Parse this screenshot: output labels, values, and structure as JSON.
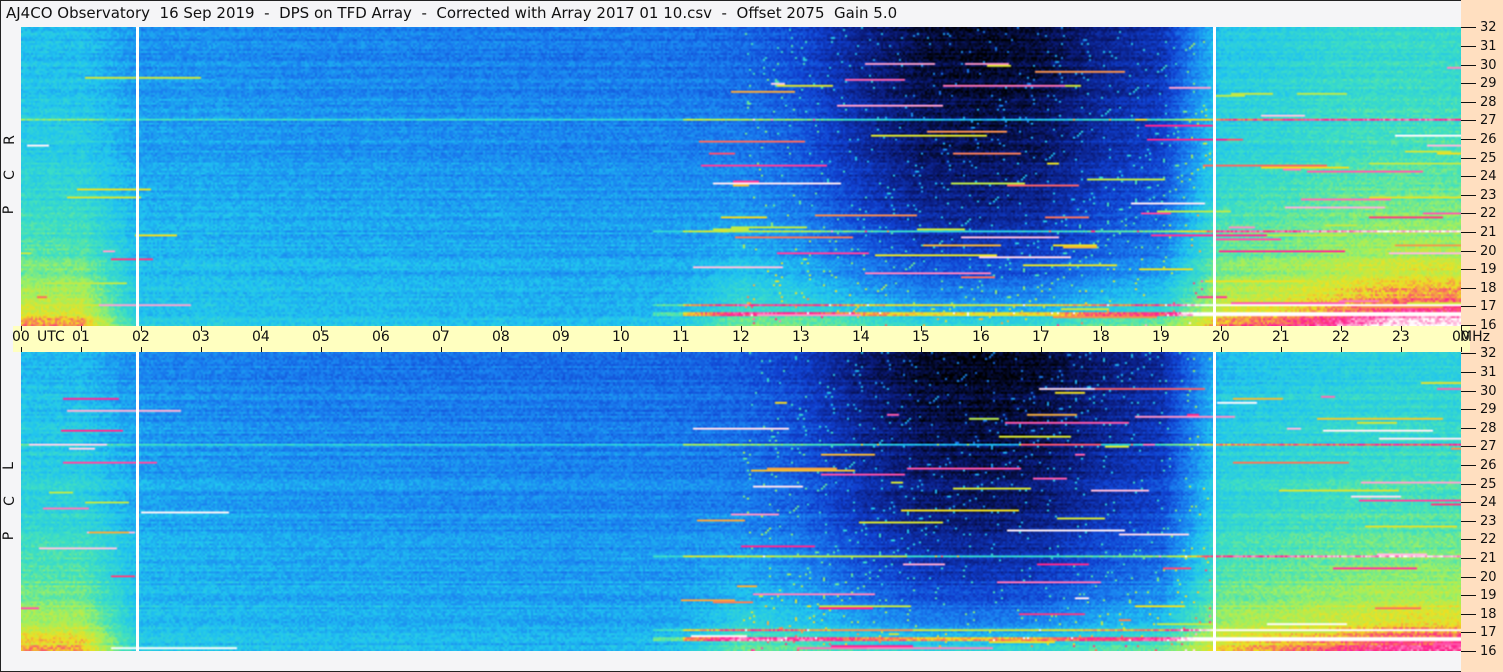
{
  "title": "AJ4CO Observatory  16 Sep 2019  -  DPS on TFD Array  -  Corrected with Array 2017 01 10.csv  -  Offset 2075  Gain 5.0",
  "chart_data": {
    "type": "heatmap",
    "title": "AJ4CO Observatory  16 Sep 2019  -  DPS on TFD Array  -  Corrected with Array 2017 01 10.csv  -  Offset 2075  Gain 5.0",
    "xlabel": "UTC",
    "ylabel": "MHz",
    "x_tick_labels": [
      "00",
      "01",
      "02",
      "03",
      "04",
      "05",
      "06",
      "07",
      "08",
      "09",
      "10",
      "11",
      "12",
      "13",
      "14",
      "15",
      "16",
      "17",
      "18",
      "19",
      "20",
      "21",
      "22",
      "23",
      "00"
    ],
    "xlim_hours": [
      0,
      24
    ],
    "y_tick_labels": [
      "16",
      "17",
      "18",
      "19",
      "20",
      "21",
      "22",
      "23",
      "24",
      "25",
      "26",
      "27",
      "28",
      "29",
      "30",
      "31",
      "32"
    ],
    "ylim_mhz": [
      16,
      32
    ],
    "panels": [
      {
        "name": "RCP",
        "letters": [
          "R",
          "C",
          "P"
        ],
        "hourly_mean_intensity": [
          0.48,
          0.48,
          0.4,
          0.4,
          0.39,
          0.38,
          0.38,
          0.37,
          0.37,
          0.36,
          0.36,
          0.35,
          0.33,
          0.27,
          0.17,
          0.09,
          0.07,
          0.09,
          0.17,
          0.22,
          0.5,
          0.52,
          0.55,
          0.56
        ],
        "hourly_low_freq_boost": [
          0.3,
          0.3,
          0.02,
          0.02,
          0.02,
          0.02,
          0.02,
          0.02,
          0.02,
          0.02,
          0.03,
          0.06,
          0.25,
          0.3,
          0.35,
          0.38,
          0.4,
          0.4,
          0.38,
          0.35,
          0.28,
          0.3,
          0.34,
          0.4
        ]
      },
      {
        "name": "LCP",
        "letters": [
          "L",
          "C",
          "P"
        ],
        "hourly_mean_intensity": [
          0.48,
          0.48,
          0.4,
          0.39,
          0.38,
          0.37,
          0.37,
          0.36,
          0.36,
          0.35,
          0.35,
          0.34,
          0.32,
          0.26,
          0.16,
          0.09,
          0.07,
          0.09,
          0.16,
          0.21,
          0.49,
          0.51,
          0.53,
          0.54
        ],
        "hourly_low_freq_boost": [
          0.3,
          0.3,
          0.02,
          0.02,
          0.02,
          0.02,
          0.02,
          0.02,
          0.02,
          0.02,
          0.03,
          0.06,
          0.25,
          0.3,
          0.35,
          0.38,
          0.4,
          0.4,
          0.38,
          0.35,
          0.26,
          0.28,
          0.3,
          0.34
        ]
      }
    ],
    "interference_lines_mhz": [
      27.1,
      21.1,
      17.2,
      16.7
    ],
    "gap_markers_utc_hours": [
      1.92,
      19.87
    ],
    "colormap": [
      "#000000",
      "#0a1a78",
      "#1040d0",
      "#1a80f0",
      "#20c4f0",
      "#40e0c0",
      "#a0f060",
      "#f0e020",
      "#ff2090",
      "#ffffff"
    ],
    "grid": false
  }
}
